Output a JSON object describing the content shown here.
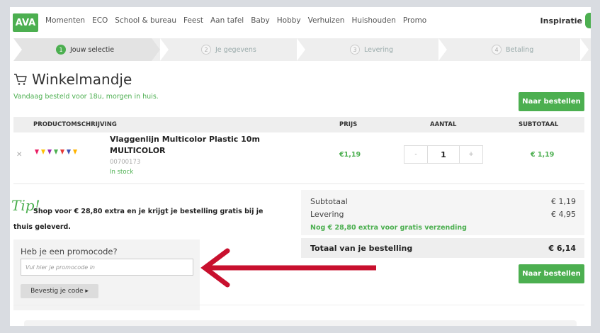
{
  "nav": {
    "logo": "AVA",
    "items": [
      "Momenten",
      "ECO",
      "School & bureau",
      "Feest",
      "Aan tafel",
      "Baby",
      "Hobby",
      "Verhuizen",
      "Huishouden",
      "Promo"
    ],
    "inspiratie": "Inspiratie"
  },
  "steps": [
    {
      "num": "1",
      "label": "Jouw selectie"
    },
    {
      "num": "2",
      "label": "Je gegevens"
    },
    {
      "num": "3",
      "label": "Levering"
    },
    {
      "num": "4",
      "label": "Betaling"
    }
  ],
  "cart": {
    "title": "Winkelmandje",
    "delivery_note": "Vandaag besteld voor 18u, morgen in huis.",
    "order_button": "Naar bestellen"
  },
  "table": {
    "headers": {
      "product": "PRODUCTOMSCHRIJVING",
      "price": "PRIJS",
      "qty": "AANTAL",
      "subtotal": "SUBTOTAAL"
    },
    "rows": [
      {
        "remove": "✕",
        "name": "Vlaggenlijn Multicolor Plastic 10m MULTICOLOR",
        "sku": "00700173",
        "stock": "In stock",
        "price": "€1,19",
        "qty_minus": "-",
        "qty": "1",
        "qty_plus": "+",
        "subtotal": "€ 1,19"
      }
    ]
  },
  "tip": {
    "word": "Tip!",
    "text": "Shop voor € 28,80 extra en je krijgt je bestelling gratis bij je thuis geleverd."
  },
  "summary": {
    "subtotal_label": "Subtotaal",
    "subtotal_value": "€ 1,19",
    "shipping_label": "Levering",
    "shipping_value": "€ 4,95",
    "free_shipping": "Nog € 28,80 extra voor gratis verzending",
    "total_label": "Totaal van je bestelling",
    "total_value": "€ 6,14",
    "order_button": "Naar bestellen"
  },
  "promo": {
    "title": "Heb je een promocode?",
    "placeholder": "Vul hier je promocode in",
    "button": "Bevestig je code ▸"
  },
  "colors": {
    "accent_green": "#4caf50",
    "arrow_red": "#c8102e"
  }
}
